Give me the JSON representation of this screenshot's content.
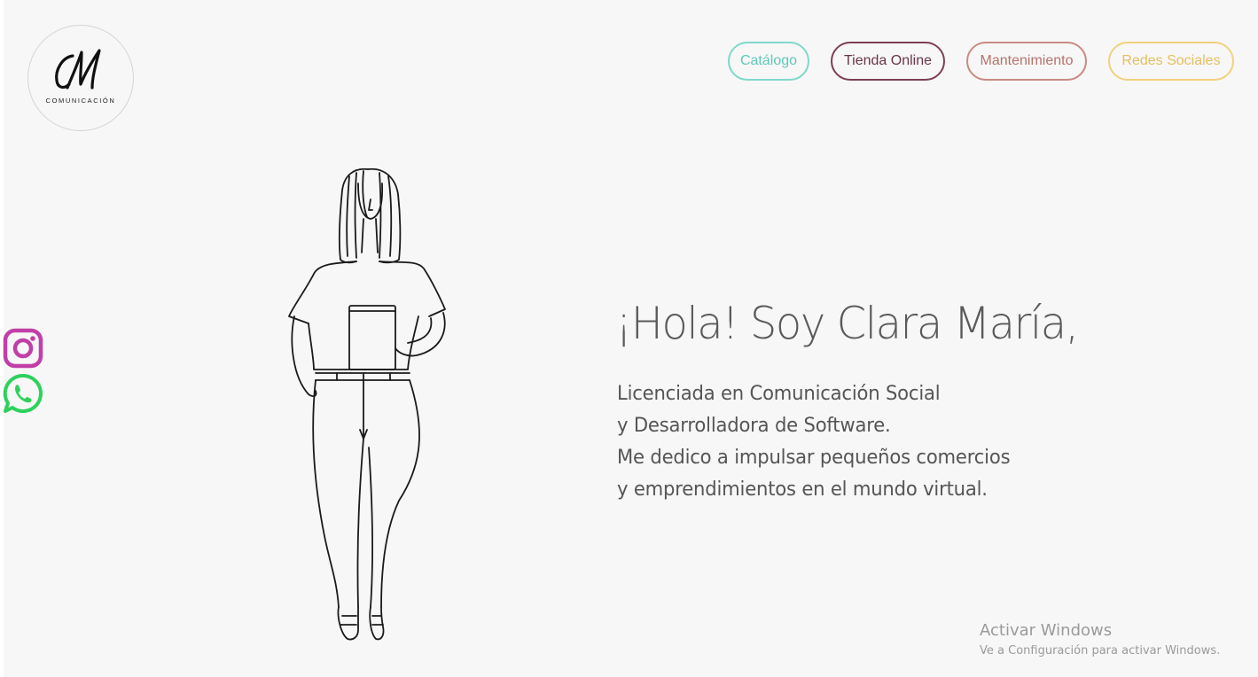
{
  "logo": {
    "monogram": "CM",
    "subtitle": "COMUNICACIÓN"
  },
  "nav": {
    "items": [
      {
        "label": "Catálogo",
        "color": "#7fd8cc"
      },
      {
        "label": "Tienda Online",
        "color": "#7d3f55"
      },
      {
        "label": "Mantenimiento",
        "color": "#c98b83"
      },
      {
        "label": "Redes Sociales",
        "color": "#f2d07e"
      }
    ]
  },
  "social": {
    "items": [
      {
        "icon": "instagram-icon",
        "color": "#c13fa8"
      },
      {
        "icon": "whatsapp-icon",
        "color": "#2ed15b"
      }
    ]
  },
  "hero": {
    "title": "¡Hola! Soy Clara María,",
    "lines": [
      "Licenciada en Comunicación Social",
      "y Desarrolladora de Software.",
      "Me dedico a impulsar pequeños comercios",
      "y emprendimientos en el mundo virtual."
    ]
  },
  "watermark": {
    "title": "Activar Windows",
    "subtitle": "Ve a Configuración para activar Windows."
  }
}
